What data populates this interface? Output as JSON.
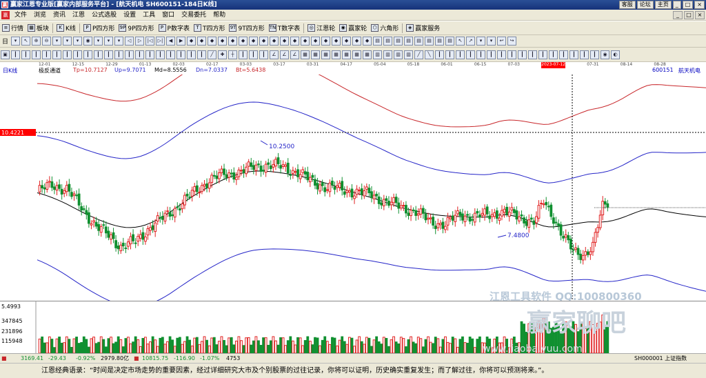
{
  "titlebar": {
    "app_icon": "赢",
    "title": "赢家江恩专业版[赢家内部服务平台] - [航天机电  SH600151-184日K线]",
    "buttons": [
      "客服",
      "论坛",
      "主页",
      "_",
      "□",
      "×"
    ]
  },
  "menubar": {
    "icon": "赢",
    "items": [
      "文件",
      "浏览",
      "资讯",
      "江恩",
      "公式选股",
      "设置",
      "工具",
      "窗口",
      "交易委托",
      "帮助"
    ],
    "window_controls": [
      "_",
      "□",
      "×"
    ]
  },
  "toolbar1": {
    "items": [
      {
        "icon": "list-icon",
        "glyph": "≡",
        "label": "行情"
      },
      {
        "icon": "grid-icon",
        "glyph": "▦",
        "label": "板块"
      },
      {
        "icon": "kline-icon",
        "glyph": "K",
        "label": "K线"
      },
      {
        "icon": "p-square-icon",
        "glyph": "P",
        "label": "P四方形"
      },
      {
        "icon": "9p-icon",
        "glyph": "9P",
        "label": "9P四方形"
      },
      {
        "icon": "p-number-icon",
        "glyph": "P",
        "label": "P数字表"
      },
      {
        "icon": "t-square-icon",
        "glyph": "T",
        "label": "T四方形"
      },
      {
        "icon": "9t-icon",
        "glyph": "9T",
        "label": "9T四方形"
      },
      {
        "icon": "t-number-icon",
        "glyph": "TN",
        "label": "T数字表"
      },
      {
        "icon": "gann-wheel-icon",
        "glyph": "◎",
        "label": "江恩轮"
      },
      {
        "icon": "winner-wheel-icon",
        "glyph": "◉",
        "label": "赢家轮"
      },
      {
        "icon": "hexagon-icon",
        "glyph": "⬡",
        "label": "六角形"
      },
      {
        "icon": "service-icon",
        "glyph": "◈",
        "label": "赢家服务"
      }
    ]
  },
  "toolbar2": {
    "day_selector": "日",
    "glyphs": [
      "▾",
      "↖",
      "⊕",
      "⊖",
      "▾",
      "▾",
      "▾",
      "◉",
      "▾",
      "▾",
      "▾",
      "◁",
      "▷",
      "|◁",
      "▷|",
      "◀",
      "▶",
      "◆",
      "◆",
      "◆",
      "◆",
      "◆",
      "◆",
      "◆",
      "◆",
      "◆",
      "◆",
      "◆",
      "◆",
      "◆",
      "◆",
      "◆",
      "◆",
      "◆",
      "◆",
      "▤",
      "▤",
      "▤",
      "▤",
      "▤",
      "▤",
      "▤",
      "▤",
      "↖",
      "↗",
      "▾",
      "▾",
      "↩",
      "↪"
    ]
  },
  "toolbar3": {
    "glyphs": [
      "▣",
      "┃",
      "┃",
      "┃",
      "┃",
      "┃",
      "┃",
      "┃",
      "┃",
      "┃",
      "┃",
      "┃",
      "┃",
      "┃",
      "┃",
      "┃",
      "┃",
      "┃",
      "┃",
      "┃",
      "╱",
      "✚",
      "┼",
      "┃",
      "┃",
      "┃",
      "∠",
      "∠",
      "∠",
      "▦",
      "▦",
      "▦",
      "▦",
      "▦",
      "▦",
      "▦",
      "▥",
      "▥",
      "▥",
      "▥",
      "╱",
      "╲",
      "┃",
      "┃",
      "┃",
      "┃",
      "┃",
      "┃",
      "┃",
      "┃",
      "┃",
      "┃",
      "┃",
      "┃",
      "┃",
      "┃",
      "┃",
      "┃",
      "◉",
      "◐"
    ]
  },
  "datebar": [
    "12-01",
    "12-15",
    "12-29",
    "01-13",
    "02-03",
    "02-17",
    "03-03",
    "03-17",
    "03-31",
    "04-17",
    "05-04",
    "05-18",
    "06-01",
    "06-15",
    "07-03",
    "2023-07-12",
    "07-31",
    "08-14",
    "08-28"
  ],
  "chart_header": {
    "period": "日K线",
    "indicator_name": "极反通道",
    "tp": "Tp=10.7127",
    "up": "Up=9.7071",
    "md": "Md=8.5556",
    "dn": "Dn=7.0337",
    "bt": "Bt=5.6438",
    "crosshair_date": "2023-07-12",
    "stock_code": "600151",
    "stock_name": "航天机电"
  },
  "price_label": "10.4221",
  "vol_labels": [
    "5.4993",
    "347845",
    "231896",
    "115948"
  ],
  "chart_data": {
    "type": "candlestick",
    "annotations": [
      {
        "text": "10.2500",
        "type": "high"
      },
      {
        "text": "7.4800",
        "type": "low"
      }
    ],
    "close_start": 8.75,
    "price_path": [
      [
        0,
        8.8
      ],
      [
        6,
        8.95
      ],
      [
        12,
        8.85
      ],
      [
        18,
        8.5
      ],
      [
        24,
        8.1
      ],
      [
        30,
        7.9
      ],
      [
        34,
        7.7
      ],
      [
        40,
        7.8
      ],
      [
        46,
        8.1
      ],
      [
        52,
        8.3
      ],
      [
        58,
        8.55
      ],
      [
        64,
        8.8
      ],
      [
        70,
        9.05
      ],
      [
        76,
        9.15
      ],
      [
        82,
        9.2
      ],
      [
        88,
        9.3
      ],
      [
        94,
        9.35
      ],
      [
        100,
        9.3
      ],
      [
        106,
        9.2
      ],
      [
        112,
        9.0
      ],
      [
        118,
        8.9
      ],
      [
        124,
        8.85
      ],
      [
        130,
        8.8
      ],
      [
        136,
        8.75
      ],
      [
        142,
        8.6
      ],
      [
        148,
        8.5
      ],
      [
        154,
        8.4
      ],
      [
        160,
        8.2
      ],
      [
        166,
        8.15
      ],
      [
        172,
        8.35
      ],
      [
        178,
        8.3
      ],
      [
        184,
        8.35
      ],
      [
        190,
        8.4
      ],
      [
        196,
        8.3
      ],
      [
        202,
        8.2
      ],
      [
        206,
        8.6
      ],
      [
        210,
        8.3
      ],
      [
        214,
        7.9
      ],
      [
        218,
        7.6
      ],
      [
        222,
        7.55
      ],
      [
        226,
        7.7
      ],
      [
        230,
        8.5
      ],
      [
        234,
        8.7
      ],
      [
        238,
        8.6
      ],
      [
        244,
        8.5
      ],
      [
        250,
        8.45
      ],
      [
        256,
        8.4
      ],
      [
        262,
        8.35
      ],
      [
        268,
        8.3
      ],
      [
        272,
        8.25
      ]
    ]
  },
  "watermark": {
    "line1": "江恩工具软件 QQ:100800360",
    "line2": "赢家聊吧",
    "line3": "www.jiaoba.yuu.com"
  },
  "statusbar": {
    "sh_index": "3169.41",
    "sh_change": "-29.43",
    "sh_pct": "-0.92%",
    "sh_amount": "2979.80亿",
    "sz_index": "10815.75",
    "sz_change": "-116.90",
    "sz_pct": "-1.07%",
    "sz_amount": "4753",
    "right_label": "SH000001 上证指数"
  },
  "quote": "江恩经典语录：“时间是决定市场走势的重要因素，经过详细研究大市及个别股票的过往记录，你将可以证明，历史确实重复发生；而了解过往，你将可以预测将来。”。",
  "colors": {
    "red_band": "#c8262a",
    "blue_band": "#2424c8",
    "up_candle": "#e02020",
    "down_candle": "#109030"
  }
}
